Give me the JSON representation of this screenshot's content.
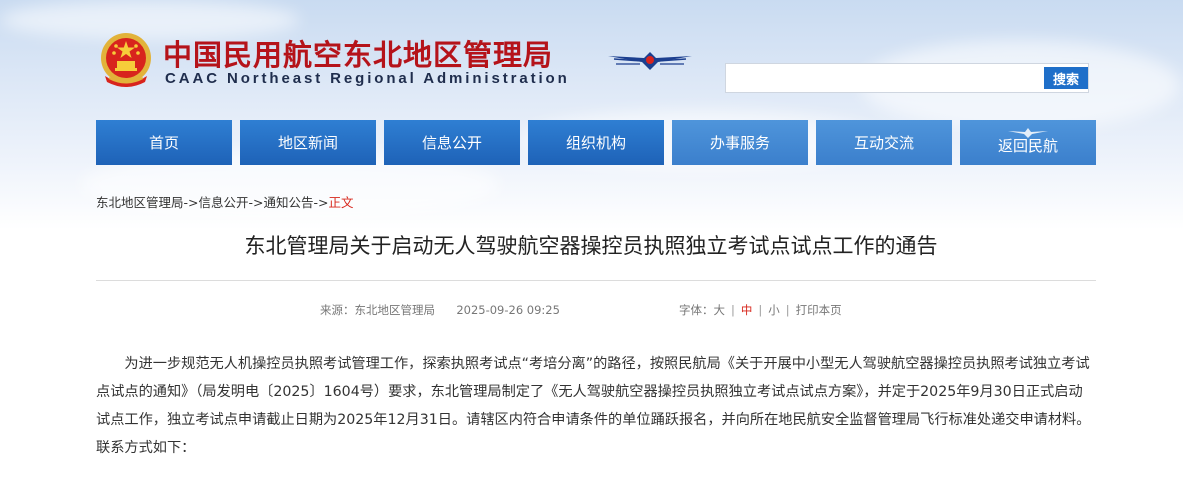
{
  "header": {
    "title": "中国民用航空东北地区管理局",
    "subtitle": "CAAC Northeast Regional Administration",
    "emblem_icon": "national-emblem-icon",
    "logo_icon": "caac-wings-logo-icon",
    "search": {
      "placeholder": "",
      "button_label": "搜索"
    }
  },
  "nav": {
    "items": [
      {
        "label": "首页"
      },
      {
        "label": "地区新闻"
      },
      {
        "label": "信息公开"
      },
      {
        "label": "组织机构"
      },
      {
        "label": "办事服务"
      },
      {
        "label": "互动交流"
      },
      {
        "label": "返回民航"
      }
    ]
  },
  "breadcrumb": {
    "items": [
      "东北地区管理局",
      "信息公开",
      "通知公告"
    ],
    "separator": "->",
    "current": "正文"
  },
  "article": {
    "title": "东北管理局关于启动无人驾驶航空器操控员执照独立考试点试点工作的通告",
    "source_label": "来源：",
    "source": "东北地区管理局",
    "date": "2025-09-26 09:25",
    "font_size_label": "字体：",
    "font_options": [
      "大",
      "中",
      "小"
    ],
    "selected_font": "中",
    "print_label": "打印本页",
    "body": "为进一步规范无人机操控员执照考试管理工作，探索执照考试点“考培分离”的路径，按照民航局《关于开展中小型无人驾驶航空器操控员执照考试独立考试点试点的通知》（局发明电〔2025〕1604号）要求，东北管理局制定了《无人驾驶航空器操控员执照独立考试点试点方案》，并定于2025年9月30日正式启动试点工作，独立考试点申请截止日期为2025年12月31日。请辖区内符合申请条件的单位踊跃报名，并向所在地民航安全监督管理局飞行标准处递交申请材料。联系方式如下："
  },
  "colors": {
    "title_red": "#b5131a",
    "nav_blue": "#1e62b7",
    "nav_light_blue": "#3b7fcc",
    "accent_red": "#d7261b"
  }
}
